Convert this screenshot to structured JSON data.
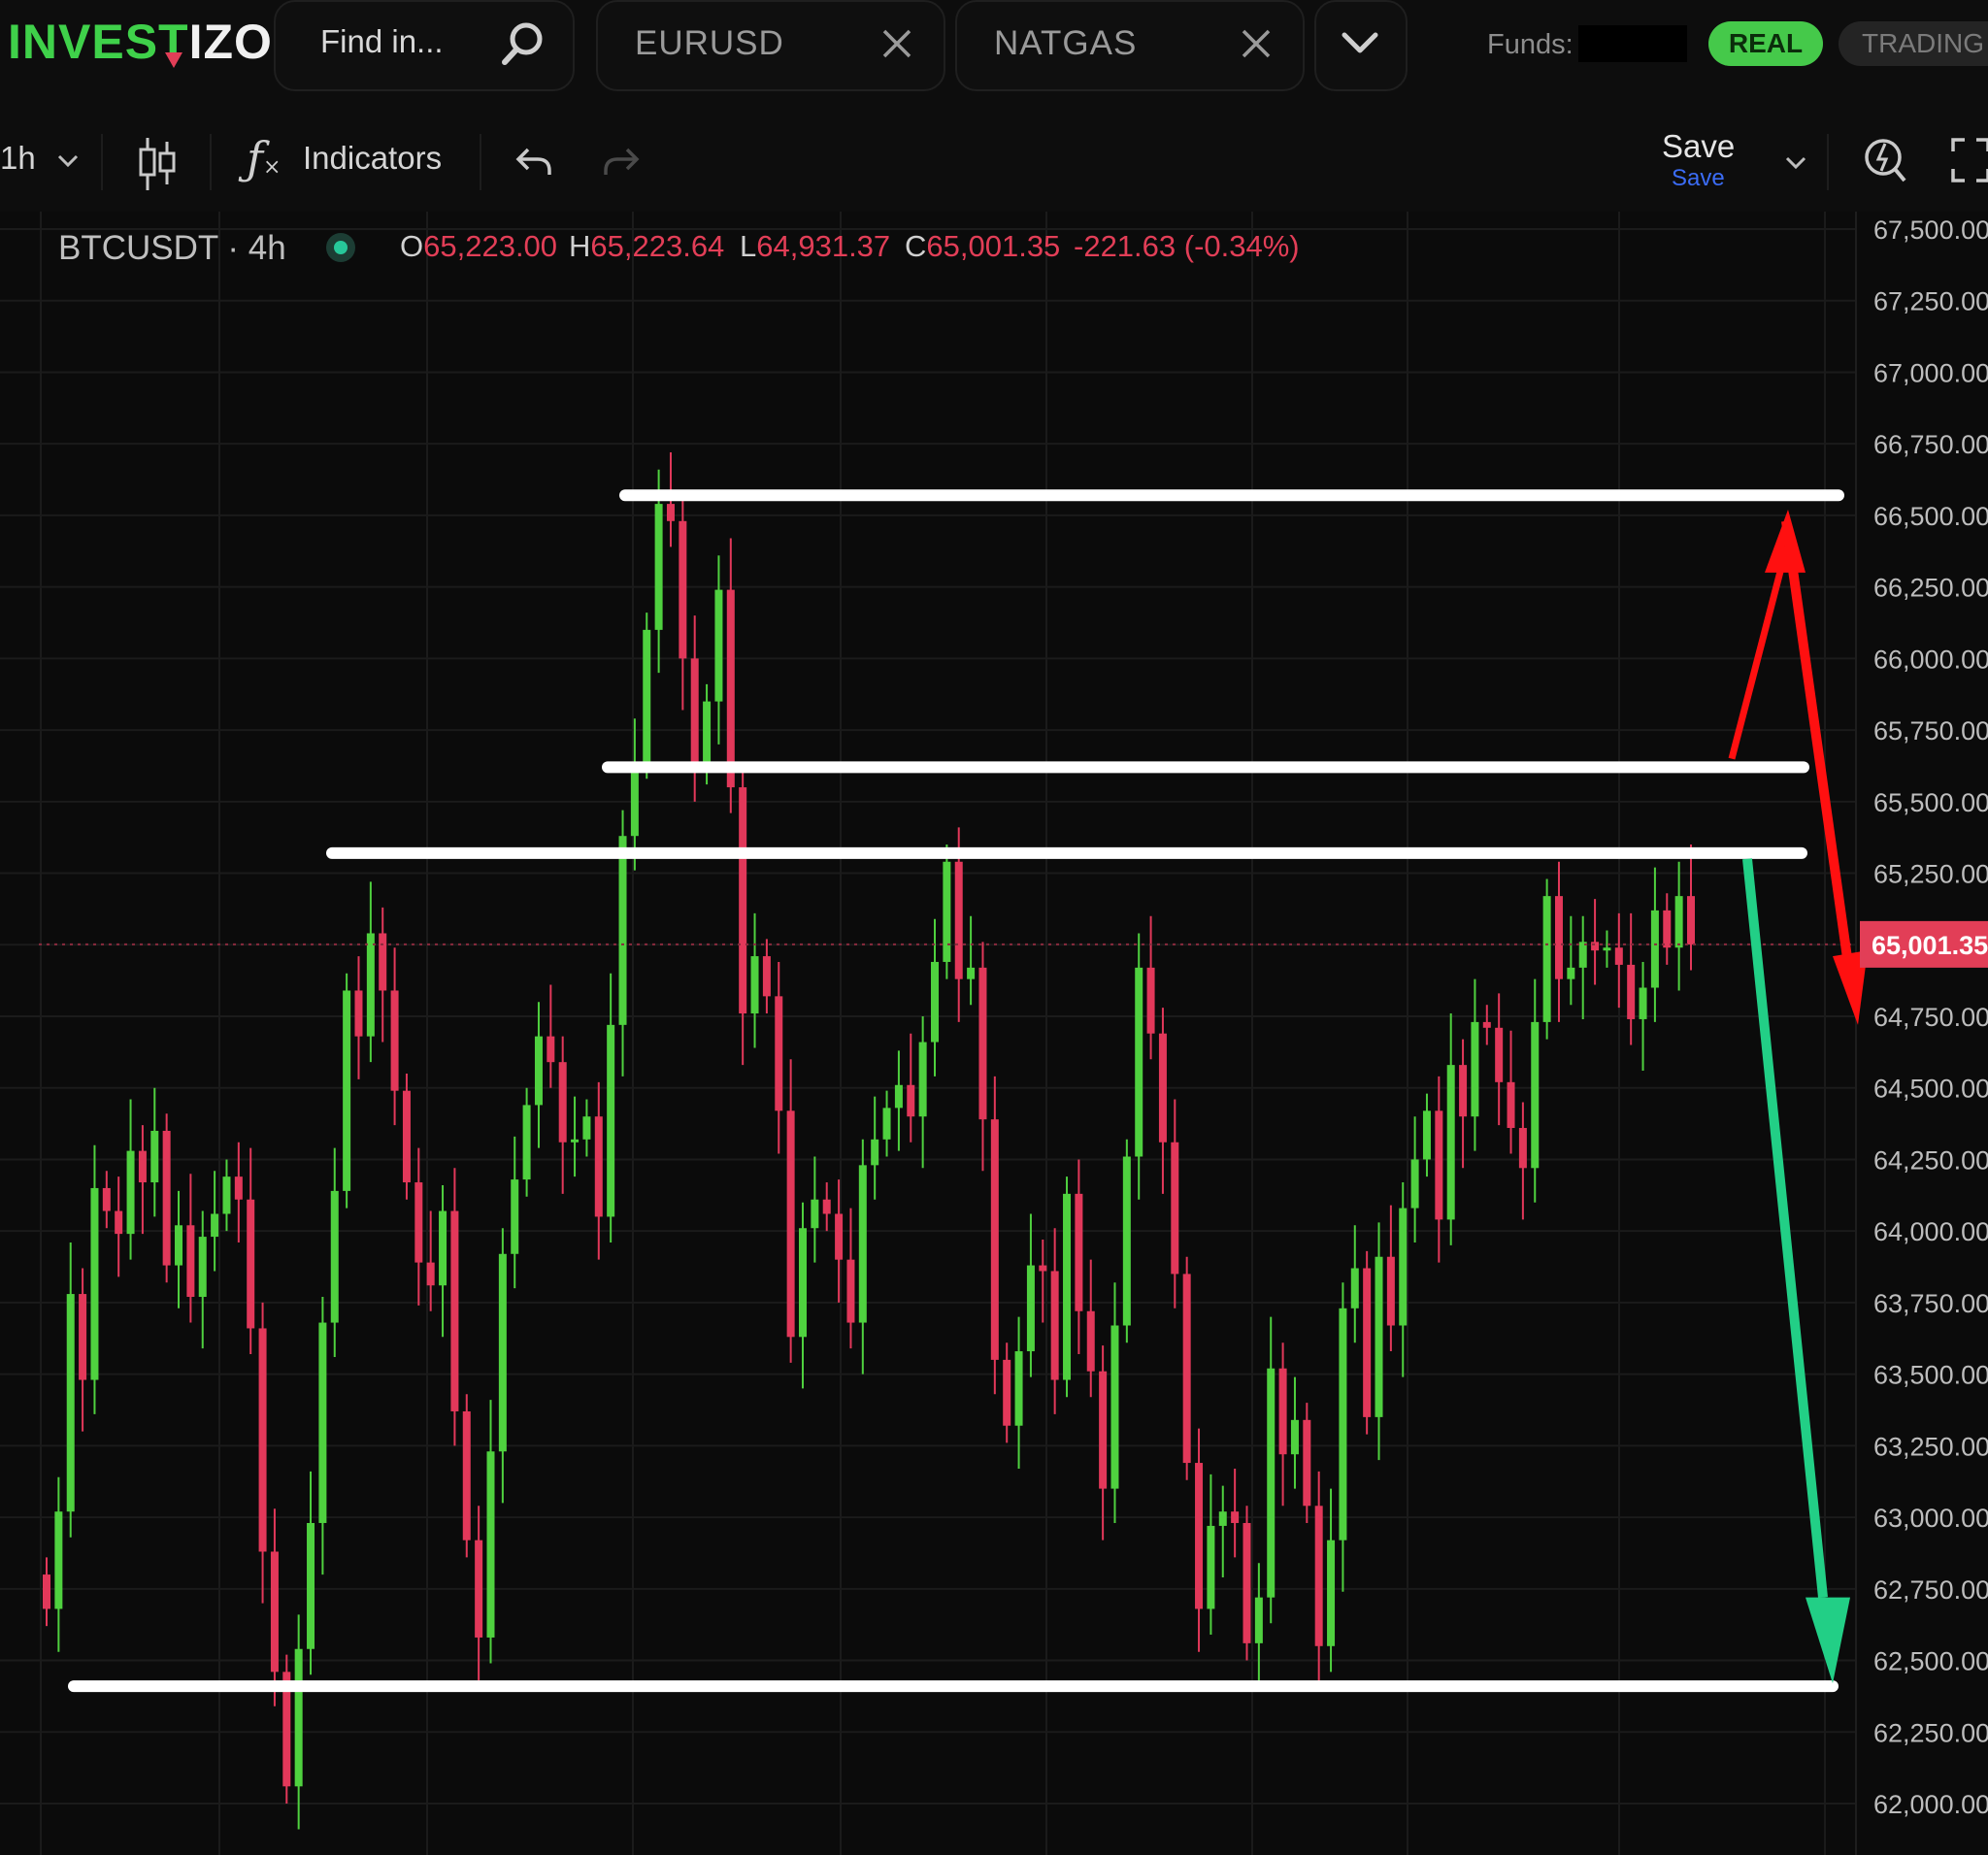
{
  "app": {
    "logo_text_a": "INVEST",
    "logo_text_b": "IZO"
  },
  "search": {
    "placeholder": "Find in..."
  },
  "tabs": [
    {
      "label": "EURUSD"
    },
    {
      "label": "NATGAS"
    }
  ],
  "account": {
    "funds_label": "Funds:",
    "real_label": "REAL",
    "trading_label": "TRADING"
  },
  "toolbar": {
    "interval": "1h",
    "indicators_label": "Indicators",
    "save_label": "Save",
    "save_sub": "Save"
  },
  "legend": {
    "symbol": "BTCUSDT · 4h",
    "o_key": "O",
    "o": "65,223.00",
    "h_key": "H",
    "h": "65,223.64",
    "l_key": "L",
    "l": "64,931.37",
    "c_key": "C",
    "c": "65,001.35",
    "change": "-221.63 (-0.34%)"
  },
  "colors": {
    "up": "#4fd13f",
    "down": "#e2385a",
    "bg": "#0b0b0b",
    "grid": "#1b1b1b",
    "real_badge": "#45c94a",
    "save_sub": "#3b6cf5"
  },
  "chart_data": {
    "type": "candlestick",
    "y_axis": {
      "min": 62000,
      "max": 67500,
      "ticks": [
        "67,500.00",
        "67,250.00",
        "67,000.00",
        "66,750.00",
        "66,500.00",
        "66,250.00",
        "66,000.00",
        "65,750.00",
        "65,500.00",
        "65,250.00",
        "65,001.35",
        "64,750.00",
        "64,500.00",
        "64,250.00",
        "64,000.00",
        "63,750.00",
        "63,500.00",
        "63,250.00",
        "63,000.00",
        "62,750.00",
        "62,500.00",
        "62,250.00",
        "62,000.00"
      ]
    },
    "current_price": 65001.35,
    "current_price_label": "65,001.35",
    "horizontal_lines": [
      66570,
      65620,
      65320,
      62410
    ],
    "closes": [
      62680,
      63020,
      63780,
      63480,
      64150,
      64070,
      63990,
      64280,
      64170,
      64350,
      63880,
      64020,
      63770,
      63980,
      64060,
      64190,
      64110,
      63660,
      62880,
      62460,
      62060,
      62540,
      62980,
      63680,
      64140,
      64840,
      64680,
      65040,
      64840,
      64490,
      64170,
      63890,
      63810,
      64070,
      63370,
      62920,
      62580,
      63230,
      63920,
      64180,
      64440,
      64680,
      64590,
      64310,
      64320,
      64400,
      64050,
      64720,
      65380,
      65640,
      66100,
      66540,
      66480,
      66000,
      65620,
      65850,
      66240,
      65550,
      64760,
      64960,
      64820,
      64420,
      63630,
      64010,
      64110,
      64060,
      63900,
      63680,
      64230,
      64320,
      64430,
      64510,
      64400,
      64660,
      64940,
      65290,
      64880,
      64920,
      64390,
      63550,
      63320,
      63580,
      63880,
      63860,
      63480,
      64130,
      63720,
      63510,
      63100,
      63670,
      64260,
      64920,
      64690,
      64310,
      63850,
      63190,
      62680,
      62970,
      63020,
      62980,
      62560,
      62720,
      63520,
      63220,
      63340,
      63040,
      62550,
      62920,
      63730,
      63870,
      63350,
      63910,
      63670,
      64080,
      64250,
      64420,
      64040,
      64580,
      64400,
      64730,
      64710,
      64520,
      64360,
      64220,
      64730,
      65170,
      64880,
      64920,
      65010,
      64980,
      64990,
      64930,
      64740,
      64850,
      65120,
      64990,
      65170,
      65001
    ]
  }
}
